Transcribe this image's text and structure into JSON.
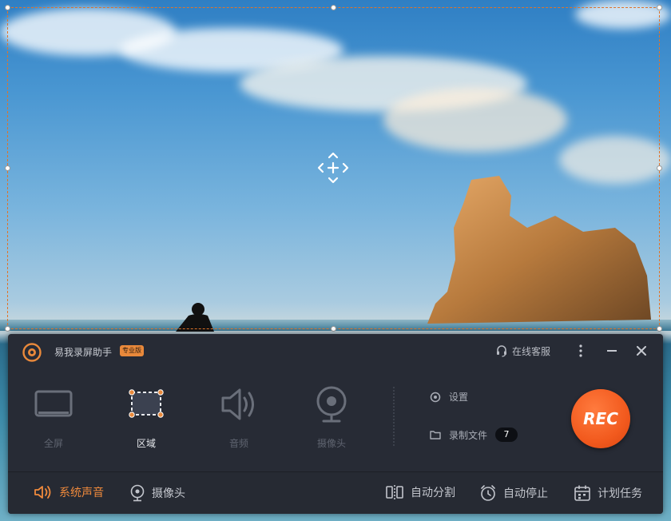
{
  "colors": {
    "accent": "#f08a3c",
    "rec_button": "#f25a1e",
    "panel_bg": "#272b35",
    "selection_border": "#e0742a"
  },
  "recorder": {
    "app_name": "易我录屏助手",
    "edition_badge": "专业版",
    "support_label": "在线客服",
    "window_controls": {
      "more_icon": "more-vertical-icon",
      "minimize_icon": "minimize-icon",
      "close_icon": "close-icon"
    },
    "modes": [
      {
        "label": "全屏",
        "icon": "monitor-icon",
        "active": false
      },
      {
        "label": "区域",
        "icon": "region-select-icon",
        "active": true
      },
      {
        "label": "音频",
        "icon": "speaker-icon",
        "active": false
      },
      {
        "label": "摄像头",
        "icon": "webcam-icon",
        "active": false
      }
    ],
    "settings_label": "设置",
    "recordings_label": "录制文件",
    "recordings_count": "7",
    "rec_label": "REC",
    "bottom": {
      "system_sound": "系统声音",
      "camera": "摄像头",
      "auto_split": "自动分割",
      "auto_stop": "自动停止",
      "scheduled_task": "计划任务"
    }
  }
}
